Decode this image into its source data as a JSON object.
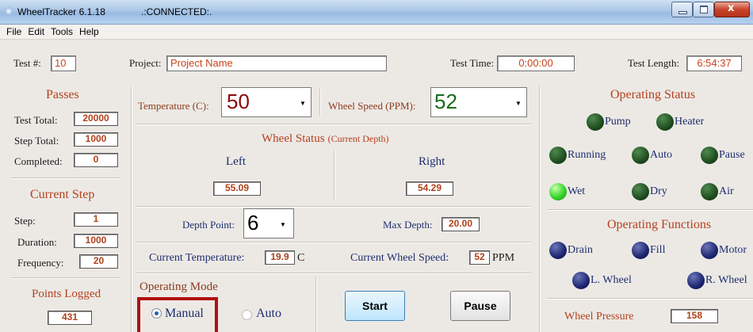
{
  "window": {
    "title": "WheelTracker 6.1.18",
    "status": ".:CONNECTED:."
  },
  "menu": [
    "File",
    "Edit",
    "Tools",
    "Help"
  ],
  "header": {
    "test_num_label": "Test #:",
    "test_num": "10",
    "project_label": "Project:",
    "project": "Project Name",
    "test_time_label": "Test Time:",
    "test_time": "0:00:00",
    "test_length_label": "Test Length:",
    "test_length": "6:54:37"
  },
  "passes": {
    "title": "Passes",
    "test_total_label": "Test Total:",
    "test_total": "20000",
    "step_total_label": "Step Total:",
    "step_total": "1000",
    "completed_label": "Completed:",
    "completed": "0"
  },
  "current_step": {
    "title": "Current Step",
    "step_label": "Step:",
    "step": "1",
    "duration_label": "Duration:",
    "duration": "1000",
    "frequency_label": "Frequency:",
    "frequency": "20"
  },
  "points_logged": {
    "title": "Points Logged",
    "value": "431"
  },
  "controls": {
    "temperature_label": "Temperature (C):",
    "temperature": "50",
    "wheel_speed_label": "Wheel Speed (PPM):",
    "wheel_speed": "52"
  },
  "wheel_status": {
    "title": "Wheel Status",
    "subtitle": "(Current Depth)",
    "left_label": "Left",
    "left": "55.09",
    "right_label": "Right",
    "right": "54.29"
  },
  "depth": {
    "depth_point_label": "Depth Point:",
    "depth_point": "6",
    "max_depth_label": "Max Depth:",
    "max_depth": "20.00"
  },
  "current": {
    "temp_label": "Current Temperature:",
    "temp": "19.9",
    "temp_unit": "C",
    "speed_label": "Current Wheel Speed:",
    "speed": "52",
    "speed_unit": "PPM"
  },
  "operating_mode": {
    "title": "Operating Mode",
    "manual": "Manual",
    "auto": "Auto"
  },
  "buttons": {
    "start": "Start",
    "pause": "Pause"
  },
  "operating_status": {
    "title": "Operating Status",
    "pump": "Pump",
    "heater": "Heater",
    "running": "Running",
    "auto": "Auto",
    "pause": "Pause",
    "wet": "Wet",
    "dry": "Dry",
    "air": "Air"
  },
  "operating_functions": {
    "title": "Operating Functions",
    "drain": "Drain",
    "fill": "Fill",
    "motor": "Motor",
    "l_wheel": "L. Wheel",
    "r_wheel": "R. Wheel"
  },
  "wheel_pressure": {
    "label": "Wheel Pressure",
    "value": "158"
  },
  "colors": {
    "accent": "#b5401c",
    "selection_frame": "#b01010",
    "led_on": "#37d629",
    "led_off": "#1f4d1f",
    "function_led": "#1d2670"
  }
}
